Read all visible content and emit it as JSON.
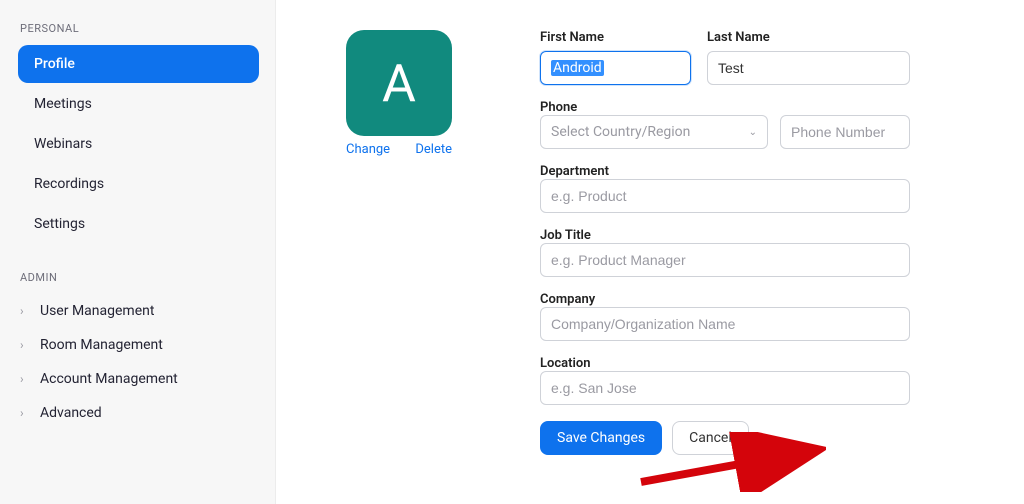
{
  "sidebar": {
    "personalHeader": "PERSONAL",
    "adminHeader": "ADMIN",
    "items": {
      "profile": "Profile",
      "meetings": "Meetings",
      "webinars": "Webinars",
      "recordings": "Recordings",
      "settings": "Settings"
    },
    "adminItems": {
      "userManagement": "User Management",
      "roomManagement": "Room Management",
      "accountManagement": "Account Management",
      "advanced": "Advanced"
    }
  },
  "avatar": {
    "letter": "A",
    "change": "Change",
    "delete": "Delete"
  },
  "form": {
    "firstNameLabel": "First Name",
    "firstNameValue": "Android",
    "lastNameLabel": "Last Name",
    "lastNameValue": "Test",
    "phoneLabel": "Phone",
    "phoneSelectPlaceholder": "Select Country/Region",
    "phoneNumberPlaceholder": "Phone Number",
    "departmentLabel": "Department",
    "departmentPlaceholder": "e.g. Product",
    "jobTitleLabel": "Job Title",
    "jobTitlePlaceholder": "e.g. Product Manager",
    "companyLabel": "Company",
    "companyPlaceholder": "Company/Organization Name",
    "locationLabel": "Location",
    "locationPlaceholder": "e.g. San Jose",
    "saveBtn": "Save Changes",
    "cancelBtn": "Cancel"
  }
}
